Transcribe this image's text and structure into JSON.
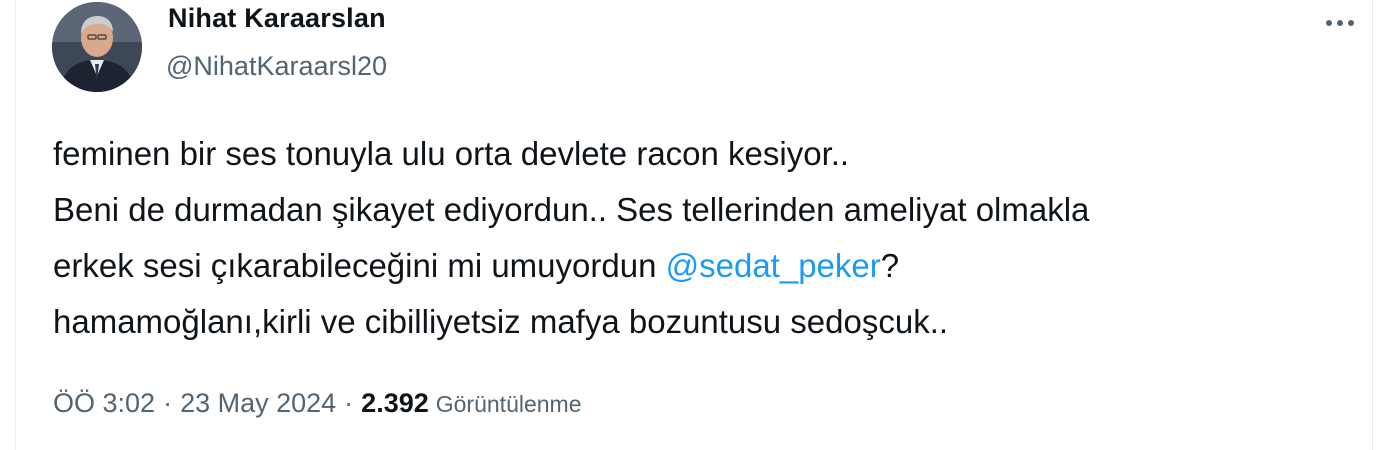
{
  "tweet": {
    "author": {
      "display_name": "Nihat Karaarslan",
      "handle": "@NihatKaraarsl20"
    },
    "more_icon": "more-horizontal-icon",
    "body": {
      "line1": "feminen bir ses tonuyla ulu orta devlete racon kesiyor..",
      "line2": "Beni de durmadan şikayet ediyordun.. Ses tellerinden ameliyat olmakla",
      "line3_before": "erkek sesi çıkarabileceğini mi umuyordun ",
      "line3_mention": "@sedat_peker",
      "line3_after": "?",
      "line4": "hamamoğlanı,kirli ve cibilliyetsiz mafya bozuntusu sedoşcuk.."
    },
    "meta": {
      "time": "ÖÖ 3:02",
      "separator": "·",
      "date": "23 May 2024",
      "views_count": "2.392",
      "views_label": "Görüntülenme"
    },
    "colors": {
      "text": "#0f1419",
      "secondary": "#536471",
      "link": "#1d9bf0"
    }
  }
}
